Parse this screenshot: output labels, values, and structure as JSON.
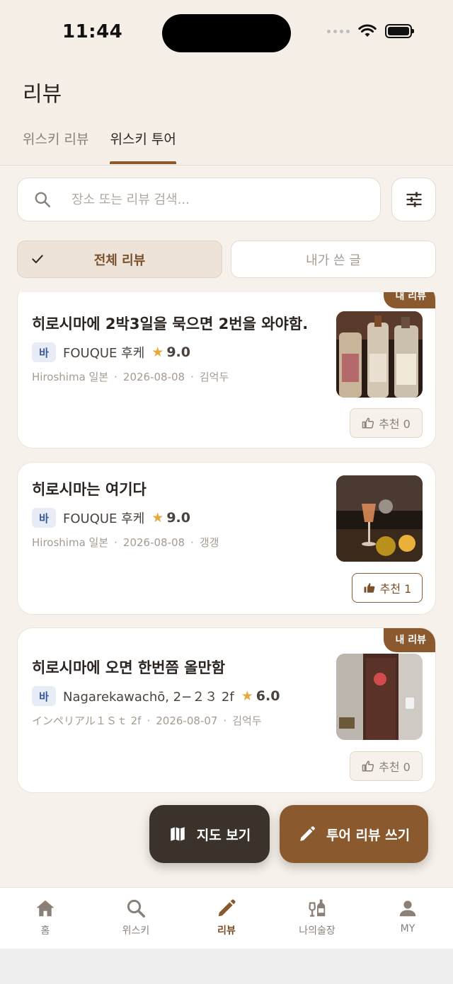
{
  "status_bar": {
    "time": "11:44"
  },
  "header": {
    "title": "리뷰",
    "tabs": [
      {
        "label": "위스키 리뷰",
        "active": false
      },
      {
        "label": "위스키 투어",
        "active": true
      }
    ]
  },
  "search": {
    "placeholder": "장소 또는 리뷰 검색..."
  },
  "segments": [
    {
      "label": "전체 리뷰",
      "selected": true
    },
    {
      "label": "내가 쓴 글",
      "selected": false
    }
  ],
  "reviews": [
    {
      "badge": "내 리뷰",
      "title": "히로시마에 2박3일을 묵으면 2번을 와야함.",
      "type": "바",
      "place": "FOUQUE 후케",
      "rating": "9.0",
      "location": "Hiroshima 일본",
      "date": "2026-08-08",
      "author": "김억두",
      "like_label": "추천 0",
      "liked": false
    },
    {
      "badge": "",
      "title": "히로시마는 여기다",
      "type": "바",
      "place": "FOUQUE 후케",
      "rating": "9.0",
      "location": "Hiroshima 일본",
      "date": "2026-08-08",
      "author": "갱갱",
      "like_label": "추천 1",
      "liked": true
    },
    {
      "badge": "내 리뷰",
      "title": "히로시마에 오면 한번쯤 올만함",
      "type": "바",
      "place": "Nagarekawachō, 2−２３ 2f",
      "rating": "6.0",
      "location": "インペリアル１Ｓｔ 2f",
      "date": "2026-08-07",
      "author": "김억두",
      "like_label": "추천 0",
      "liked": false
    }
  ],
  "fabs": {
    "map_label": "지도 보기",
    "write_label": "투어 리뷰 쓰기"
  },
  "bottom_nav": [
    {
      "label": "홈",
      "icon": "home-icon",
      "active": false
    },
    {
      "label": "위스키",
      "icon": "search-icon",
      "active": false
    },
    {
      "label": "리뷰",
      "icon": "pencil-icon",
      "active": true
    },
    {
      "label": "나의술장",
      "icon": "bottles-icon",
      "active": false
    },
    {
      "label": "MY",
      "icon": "person-icon",
      "active": false
    }
  ],
  "colors": {
    "accent": "#8a5a2e",
    "dark": "#3a322b",
    "background": "#f6f1ea",
    "star": "#e8a93c",
    "chip": "#3b5a9c"
  }
}
